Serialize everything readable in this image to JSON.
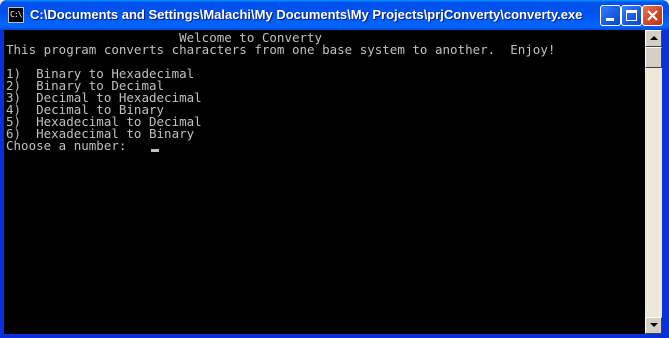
{
  "window": {
    "title": "C:\\Documents and Settings\\Malachi\\My Documents\\My Projects\\prjConverty\\converty.exe",
    "icon": "console-app-icon",
    "icon_glyph": "C:\\"
  },
  "console": {
    "lines": [
      "                       Welcome to Converty",
      "This program converts characters from one base system to another.  Enjoy!",
      "",
      "1)  Binary to Hexadecimal",
      "2)  Binary to Decimal",
      "3)  Decimal to Hexadecimal",
      "4)  Decimal to Binary",
      "5)  Hexadecimal to Decimal",
      "6)  Hexadecimal to Binary",
      "Choose a number:"
    ],
    "text_color": "#c0c0c0",
    "background": "#000000"
  },
  "colors": {
    "titlebar": "#0054e3",
    "close_button": "#d24a2c"
  }
}
